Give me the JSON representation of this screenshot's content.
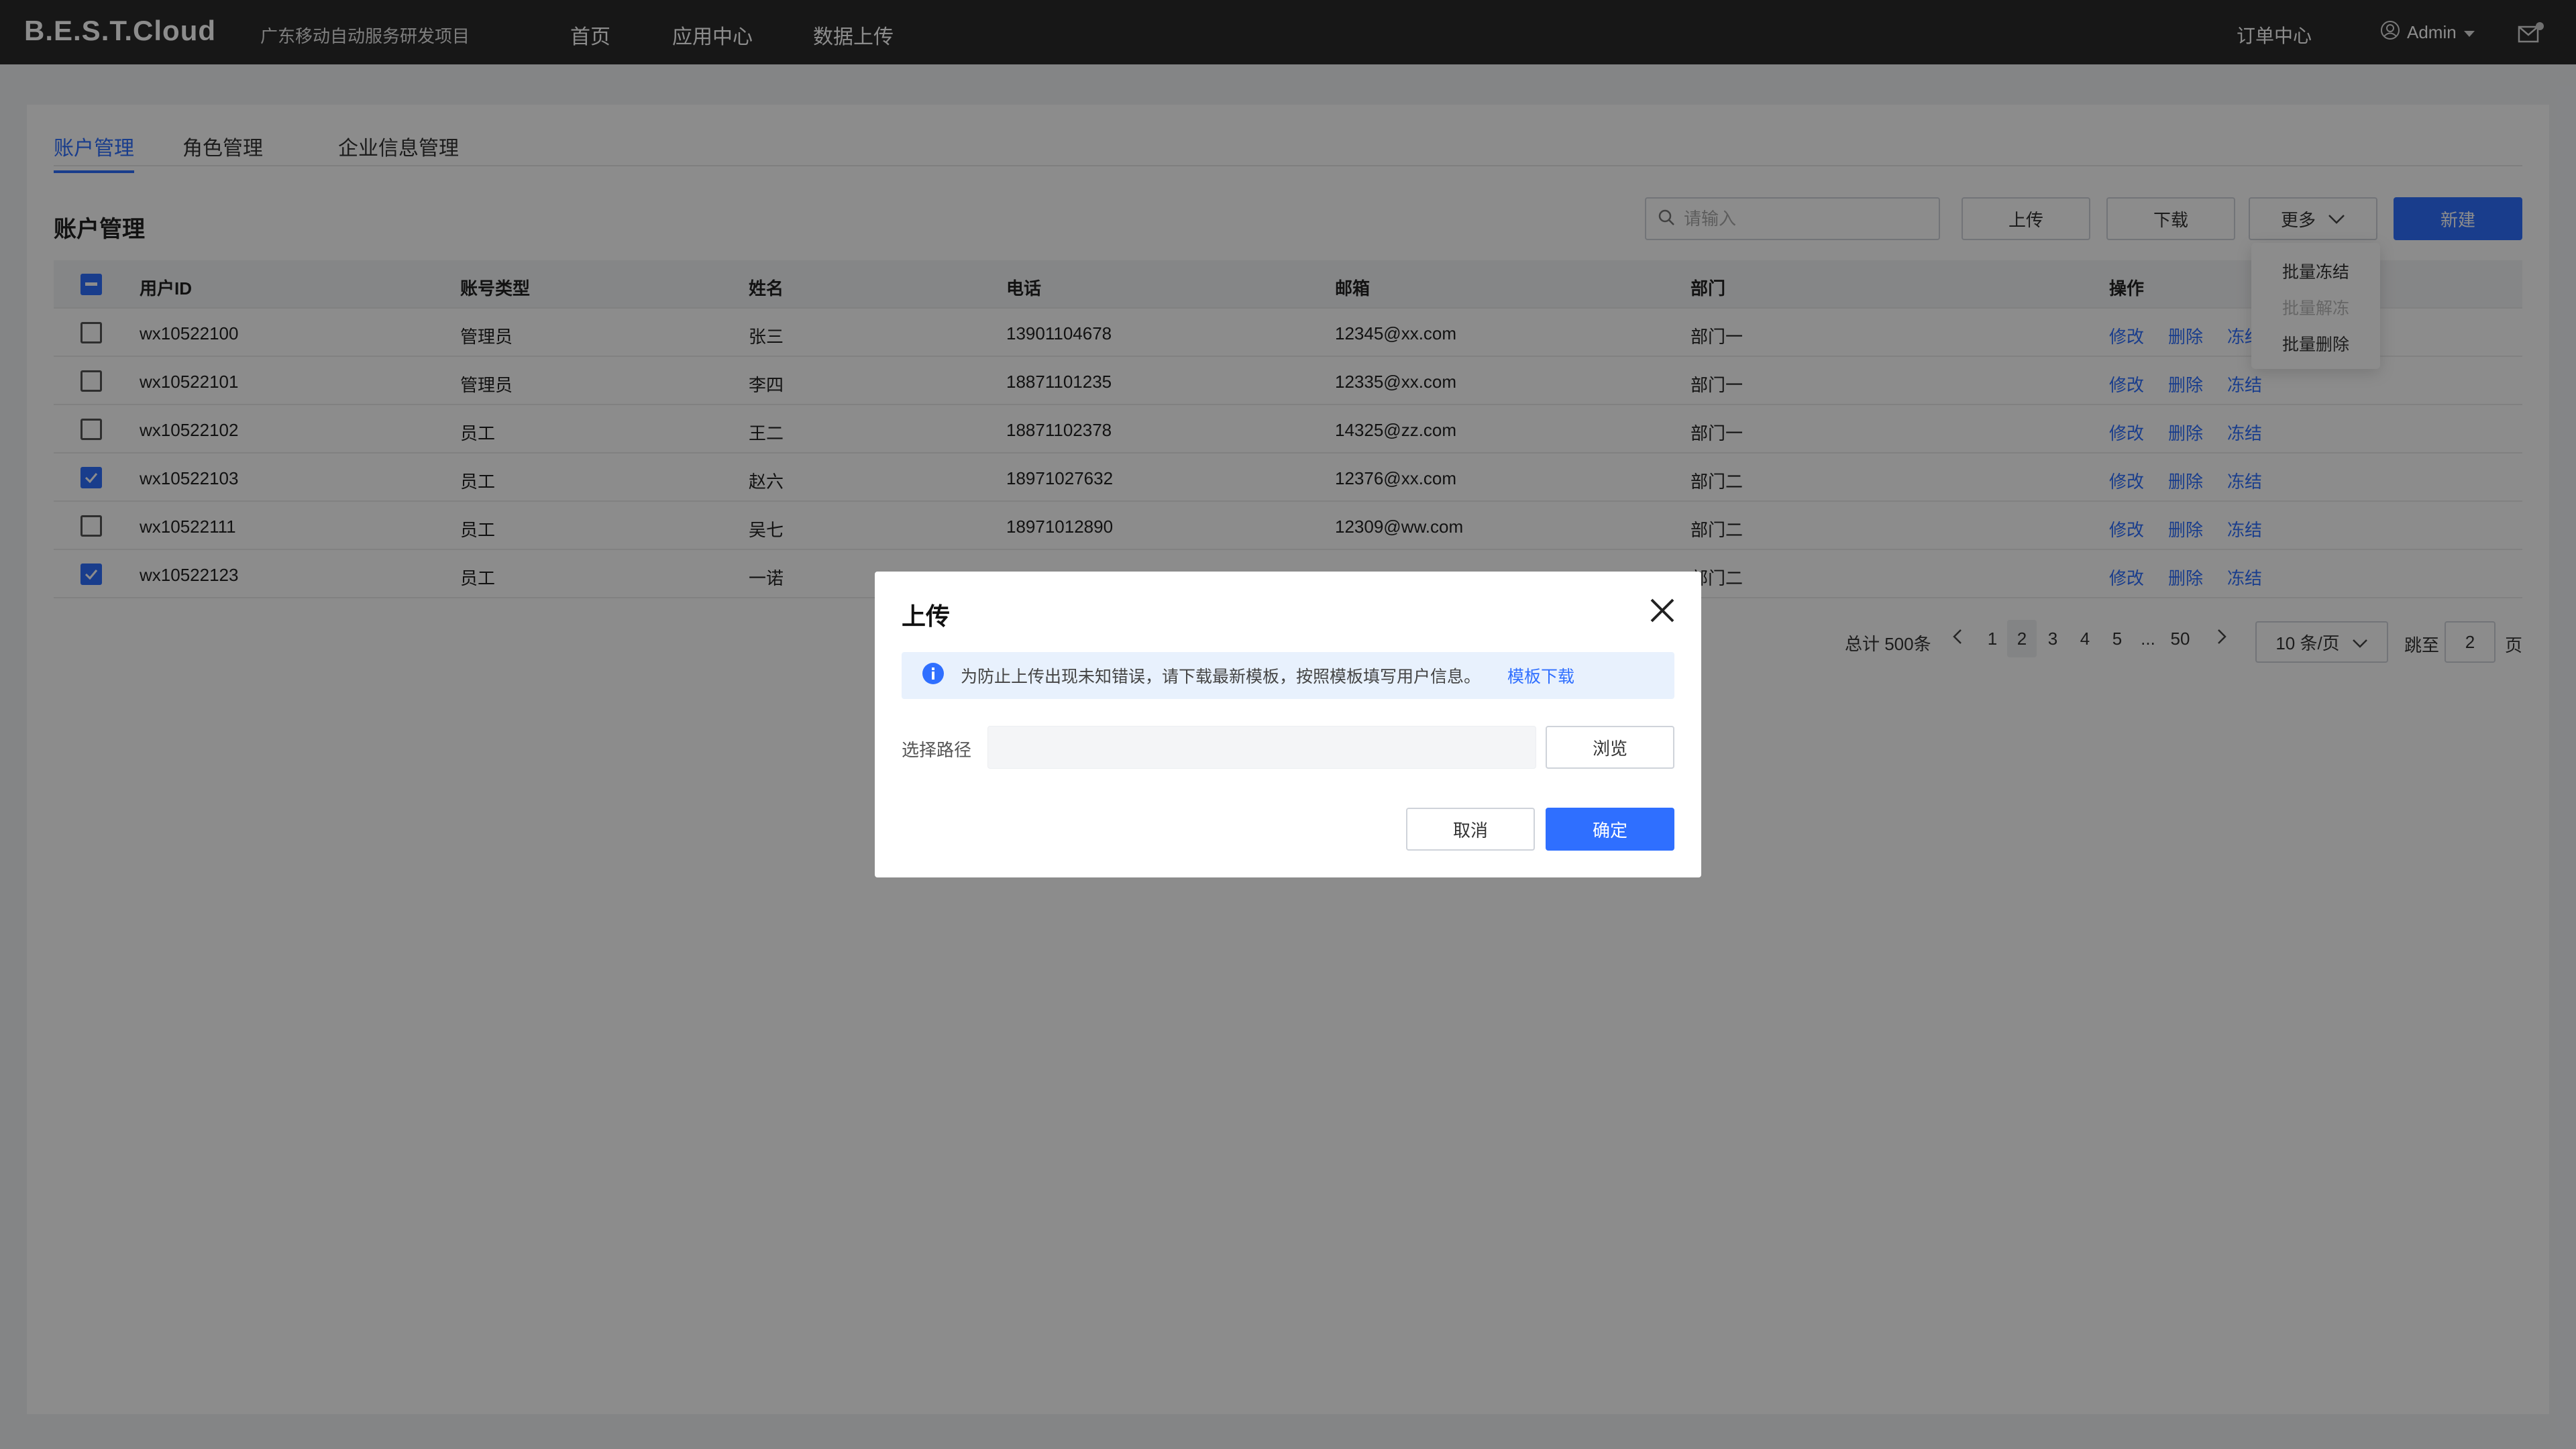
{
  "app": {
    "logo": "B.E.S.T.Cloud",
    "subtitle": "广东移动自动服务研发项目"
  },
  "nav": {
    "items": [
      "首页",
      "应用中心",
      "数据上传"
    ],
    "order_center": "订单中心",
    "user": "Admin"
  },
  "tabs": [
    {
      "label": "账户管理",
      "active": true
    },
    {
      "label": "角色管理",
      "active": false
    },
    {
      "label": "企业信息管理",
      "active": false
    }
  ],
  "section_title": "账户管理",
  "toolbar": {
    "search_placeholder": "请输入",
    "upload_label": "上传",
    "download_label": "下载",
    "more_label": "更多",
    "new_label": "新建"
  },
  "more_menu": {
    "items": [
      {
        "label": "批量冻结",
        "disabled": false
      },
      {
        "label": "批量解冻",
        "disabled": true
      },
      {
        "label": "批量删除",
        "disabled": false
      }
    ]
  },
  "table": {
    "headers": [
      "用户ID",
      "账号类型",
      "姓名",
      "电话",
      "邮箱",
      "部门",
      "操作"
    ],
    "actions": [
      "修改",
      "删除",
      "冻结"
    ],
    "rows": [
      {
        "checked": false,
        "id": "wx10522100",
        "type": "管理员",
        "name": "张三",
        "phone": "13901104678",
        "email": "12345@xx.com",
        "dept": "部门一"
      },
      {
        "checked": false,
        "id": "wx10522101",
        "type": "管理员",
        "name": "李四",
        "phone": "18871101235",
        "email": "12335@xx.com",
        "dept": "部门一"
      },
      {
        "checked": false,
        "id": "wx10522102",
        "type": "员工",
        "name": "王二",
        "phone": "18871102378",
        "email": "14325@zz.com",
        "dept": "部门一"
      },
      {
        "checked": true,
        "id": "wx10522103",
        "type": "员工",
        "name": "赵六",
        "phone": "18971027632",
        "email": "12376@xx.com",
        "dept": "部门二"
      },
      {
        "checked": false,
        "id": "wx10522111",
        "type": "员工",
        "name": "吴七",
        "phone": "18971012890",
        "email": "12309@ww.com",
        "dept": "部门二"
      },
      {
        "checked": true,
        "id": "wx10522123",
        "type": "员工",
        "name": "一诺",
        "phone": "",
        "email": "",
        "dept": "部门二"
      }
    ]
  },
  "pagination": {
    "total": "总计 500条",
    "pages": [
      "1",
      "2",
      "3",
      "4",
      "5",
      "...",
      "50"
    ],
    "current": "2",
    "page_size": "10 条/页",
    "jump_label": "跳至",
    "jump_value": "2",
    "page_suffix": "页"
  },
  "modal": {
    "title": "上传",
    "info_text": "为防止上传出现未知错误，请下载最新模板，按照模板填写用户信息。",
    "info_link": "模板下载",
    "path_label": "选择路径",
    "path_value": "",
    "browse_label": "浏览",
    "cancel_label": "取消",
    "confirm_label": "确定"
  },
  "colors": {
    "primary": "#2f6fff",
    "topbar": "#2b2b2b",
    "info_bg": "#e8f1fd"
  }
}
